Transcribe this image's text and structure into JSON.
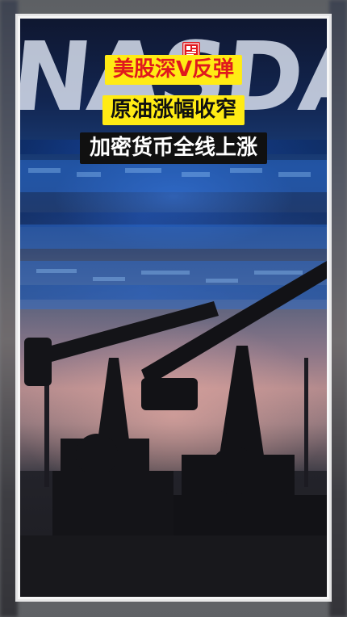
{
  "headlines": {
    "line1": "美股深V反弹",
    "line2": "原油涨幅收窄",
    "line3": "加密货币全线上涨"
  },
  "logo": {
    "icon": "newspaper-seal-icon",
    "color": "#e0191d"
  },
  "colors": {
    "banner_yellow": "#ffeb14",
    "banner_red_text": "#e0191d",
    "banner_black": "#101010"
  }
}
